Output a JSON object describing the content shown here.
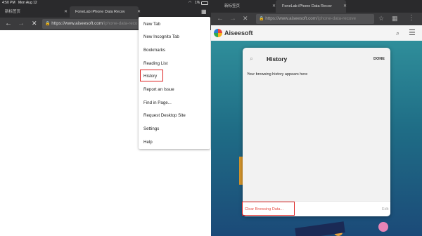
{
  "status_bar": {
    "time": "4:50 PM",
    "date": "Mon Aug 12",
    "battery": "1%"
  },
  "left": {
    "tabs": [
      {
        "label": "新标签页"
      },
      {
        "label": "FoneLab iPhone Data Recov"
      }
    ],
    "omnibox": {
      "host": "https://www.aiseesoft.com",
      "path": "/iphone-data-reco"
    },
    "menu": {
      "items": [
        {
          "label": "New Tab"
        },
        {
          "label": "New Incognito Tab"
        },
        {
          "label": "Bookmarks"
        },
        {
          "label": "Reading List"
        },
        {
          "label": "History"
        },
        {
          "label": "Report an Issue"
        },
        {
          "label": "Find in Page..."
        },
        {
          "label": "Request Desktop Site"
        },
        {
          "label": "Settings"
        },
        {
          "label": "Help"
        }
      ]
    }
  },
  "right": {
    "tabs": [
      {
        "label": "新标签页"
      },
      {
        "label": "FoneLab iPhone Data Recov"
      }
    ],
    "omnibox": {
      "host": "https://www.aiseesoft.com",
      "path": "/iphone-data-recove"
    },
    "site": {
      "brand": "Aiseesoft"
    },
    "history": {
      "title": "History",
      "done": "DONE",
      "empty_message": "Your browsing history appears here",
      "clear_label": "Clear Browsing Data...",
      "edit_label": "Edit"
    }
  },
  "colors": {
    "accent_red": "#d22222",
    "chrome_dark": "#2a2a2c",
    "toolbar": "#3b3b3d",
    "page_teal": "#2f8e9a"
  }
}
